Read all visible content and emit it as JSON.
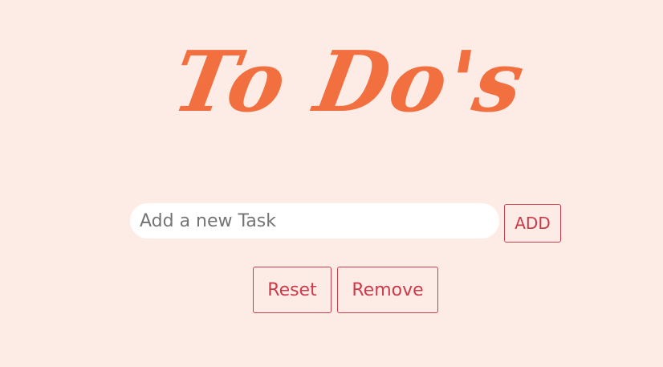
{
  "app": {
    "title": "To Do's"
  },
  "form": {
    "input_placeholder": "Add a new Task",
    "input_value": "",
    "add_label": "ADD"
  },
  "actions": {
    "reset_label": "Reset",
    "remove_label": "Remove"
  },
  "colors": {
    "background": "#fdebe6",
    "title": "#f26f40",
    "button_accent": "#cc3b4a"
  }
}
